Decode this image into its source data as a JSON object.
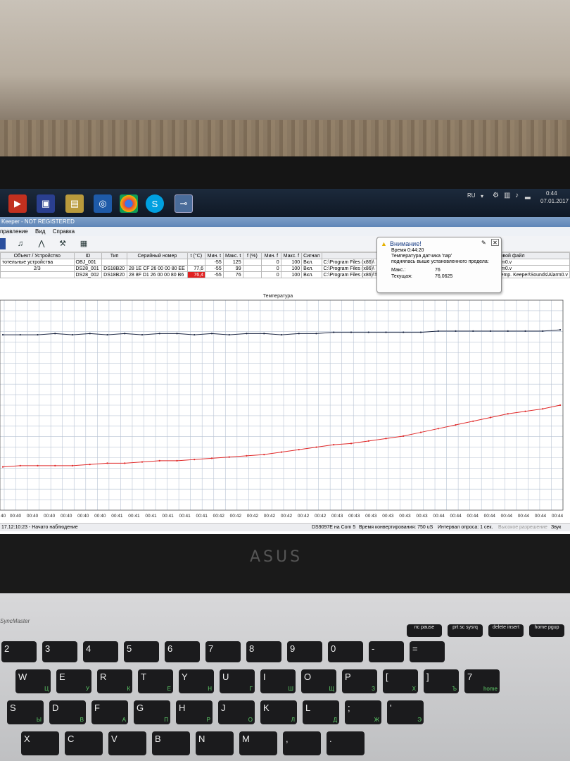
{
  "taskbar": {
    "lang": "RU",
    "time": "0:44",
    "date": "07.01.2017",
    "icons": [
      "media-player-icon",
      "save-icon",
      "folder-icon",
      "app-icon",
      "chrome-icon",
      "skype-icon",
      "thermometer-app-icon"
    ]
  },
  "window": {
    "title": "Keeper - NOT REGISTERED",
    "menu": [
      "правление",
      "Вид",
      "Справка"
    ]
  },
  "table": {
    "headers": [
      "Объект / Устройство",
      "ID",
      "Тип",
      "Серийный номер",
      "t (°C)",
      "Мин. t",
      "Макс. t",
      "f (%)",
      "Мин. f",
      "Макс. f",
      "Сигнал",
      "(Мин.",
      "звуковой файл"
    ],
    "tree": [
      "тотельные устройства",
      "2/3"
    ],
    "rows": [
      {
        "id": "OBJ_001",
        "type": "",
        "serial": "",
        "t": "",
        "min_t": "-55",
        "max_t": "125",
        "f": "",
        "min_f": "0",
        "max_f": "100",
        "signal": "Вкл.",
        "path1": "C:\\Program Files (x86)\\",
        "path2": "mp. Keeper\\Sounds\\Alarm0.v"
      },
      {
        "id": "DS28_001",
        "type": "DS18B20",
        "serial": "28 1E CF 26 00 00 80 EE",
        "t": "77,6",
        "min_t": "-55",
        "max_t": "99",
        "f": "",
        "min_f": "0",
        "max_f": "100",
        "signal": "Вкл.",
        "path1": "C:\\Program Files (x86)\\",
        "path2": "mp. Keeper\\Sounds\\Alarm0.v"
      },
      {
        "id": "DS28_002",
        "type": "DS18B20",
        "serial": "28 8F D1 26 00 00 80 B6",
        "t": "76,4",
        "min_t": "-55",
        "max_t": "76",
        "f": "",
        "min_f": "0",
        "max_f": "100",
        "signal": "Вкл.",
        "path1": "C:\\Program Files (x86)\\Temp. Keeper\\Sounds\\Alarm0.v",
        "path2": "C:\\Program Files (x86)\\Temp. Keeper\\Sounds\\Alarm0.v"
      }
    ]
  },
  "balloon": {
    "title": "Внимание!",
    "time_line": "Время 0:44:20",
    "line1": "Температура датчика 'пар'",
    "line2": "поднялась выше установленного предела:",
    "max_label": "Макс.:",
    "max_value": "76",
    "cur_label": "Текущая:",
    "cur_value": "76,0625"
  },
  "chart_data": {
    "type": "line",
    "title": "Температура",
    "x_ticks": [
      "00:40",
      "00:40",
      "00:40",
      "00:40",
      "00:40",
      "00:40",
      "00:41",
      "00:41",
      "00:41",
      "00:41",
      "00:41",
      "00:41",
      "00:42",
      "00:42",
      "00:42",
      "00:42",
      "00:42",
      "00:42",
      "00:42",
      "00:43",
      "00:43",
      "00:43",
      "00:43",
      "00:43",
      "00:43",
      "00:44",
      "00:44",
      "00:44",
      "00:44",
      "00:44",
      "00:44",
      "00:44",
      "00:44"
    ],
    "x_tick_prefix": "40",
    "grid": true,
    "series": [
      {
        "color": "#1a2440",
        "values": [
          79.2,
          79.2,
          79.2,
          79.3,
          79.2,
          79.3,
          79.2,
          79.3,
          79.2,
          79.3,
          79.3,
          79.2,
          79.3,
          79.2,
          79.3,
          79.3,
          79.2,
          79.3,
          79.3,
          79.4,
          79.4,
          79.4,
          79.4,
          79.4,
          79.4,
          79.5,
          79.5,
          79.5,
          79.5,
          79.5,
          79.5,
          79.5,
          79.6
        ]
      },
      {
        "color": "#e02a2a",
        "values": [
          68.5,
          68.6,
          68.6,
          68.6,
          68.6,
          68.7,
          68.8,
          68.8,
          68.9,
          69.0,
          69.0,
          69.1,
          69.2,
          69.3,
          69.4,
          69.5,
          69.7,
          69.9,
          70.1,
          70.3,
          70.4,
          70.6,
          70.8,
          71.0,
          71.3,
          71.6,
          71.9,
          72.2,
          72.5,
          72.8,
          73.0,
          73.2,
          73.5
        ]
      }
    ],
    "ylim": [
      65,
      82
    ]
  },
  "status": {
    "left": "17.12:10:23 - Начато наблюдение",
    "port": "DS9097E на Com 5",
    "conv": "Время конвертирования: 750 uS",
    "poll": "Интервал опроса: 1 сек.",
    "res": "Высокое разрешение",
    "sound": "Звук"
  },
  "laptop": {
    "logo": "ASUS",
    "monitor_brand": "SyncMaster"
  },
  "keys": {
    "row1": [
      {
        "m": "2",
        "s": ""
      },
      {
        "m": "3",
        "s": ""
      },
      {
        "m": "4",
        "s": ""
      },
      {
        "m": "5",
        "s": ""
      },
      {
        "m": "6",
        "s": ""
      },
      {
        "m": "7",
        "s": ""
      },
      {
        "m": "8",
        "s": ""
      },
      {
        "m": "9",
        "s": ""
      },
      {
        "m": "0",
        "s": ""
      },
      {
        "m": "-",
        "s": ""
      },
      {
        "m": "=",
        "s": ""
      }
    ],
    "row2": [
      {
        "m": "W",
        "s": "Ц"
      },
      {
        "m": "E",
        "s": "У"
      },
      {
        "m": "R",
        "s": "К"
      },
      {
        "m": "T",
        "s": "Е"
      },
      {
        "m": "Y",
        "s": "Н"
      },
      {
        "m": "U",
        "s": "Г"
      },
      {
        "m": "I",
        "s": "Ш"
      },
      {
        "m": "O",
        "s": "Щ"
      },
      {
        "m": "P",
        "s": "З"
      },
      {
        "m": "[",
        "s": "Х"
      },
      {
        "m": "]",
        "s": "Ъ"
      },
      {
        "m": "7",
        "s": "home"
      }
    ],
    "row3": [
      {
        "m": "S",
        "s": "Ы"
      },
      {
        "m": "D",
        "s": "В"
      },
      {
        "m": "F",
        "s": "А"
      },
      {
        "m": "G",
        "s": "П"
      },
      {
        "m": "H",
        "s": "Р"
      },
      {
        "m": "J",
        "s": "О"
      },
      {
        "m": "K",
        "s": "Л"
      },
      {
        "m": "L",
        "s": "Д"
      },
      {
        "m": ";",
        "s": "Ж"
      },
      {
        "m": "'",
        "s": "Э"
      }
    ],
    "row4": [
      {
        "m": "X",
        "s": ""
      },
      {
        "m": "C",
        "s": ""
      },
      {
        "m": "V",
        "s": ""
      },
      {
        "m": "B",
        "s": ""
      },
      {
        "m": "N",
        "s": ""
      },
      {
        "m": "M",
        "s": ""
      },
      {
        "m": ",",
        "s": ""
      },
      {
        "m": ".",
        "s": ""
      }
    ]
  }
}
